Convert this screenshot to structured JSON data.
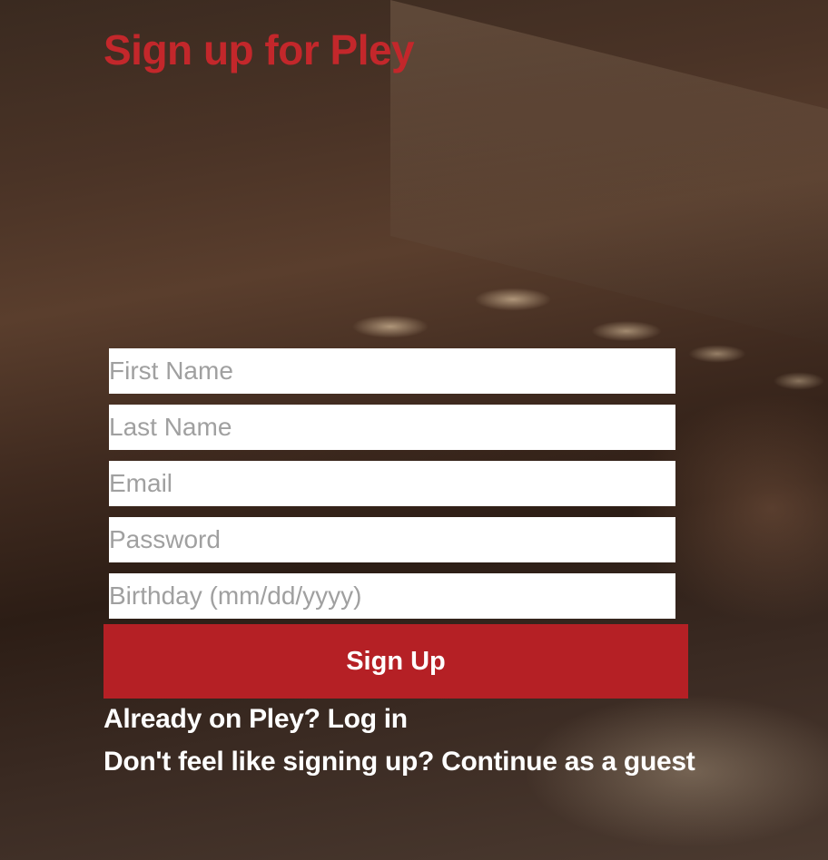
{
  "page": {
    "title": "Sign up for Pley"
  },
  "form": {
    "first_name_placeholder": "First Name",
    "last_name_placeholder": "Last Name",
    "email_placeholder": "Email",
    "password_placeholder": "Password",
    "birthday_placeholder": "Birthday (mm/dd/yyyy)",
    "submit_label": "Sign Up"
  },
  "links": {
    "login": "Already on Pley? Log in",
    "guest": "Don't feel like signing up? Continue as a guest"
  },
  "colors": {
    "accent": "#c3272b",
    "button": "#b52025",
    "link_text": "#ffffff"
  }
}
